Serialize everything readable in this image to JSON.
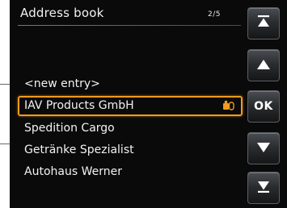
{
  "header": {
    "title": "Address book",
    "page_counter": "2/5"
  },
  "list": {
    "items": [
      {
        "label": "<new entry>",
        "selected": false
      },
      {
        "label": "IAV Products GmbH",
        "selected": true,
        "badge_icon": "contact-card-icon"
      },
      {
        "label": "Spedition Cargo",
        "selected": false
      },
      {
        "label": "Getränke Spezialist",
        "selected": false
      },
      {
        "label": "Autohaus Werner",
        "selected": false
      }
    ]
  },
  "side_buttons": {
    "page_up_icon": "page-up-icon",
    "scroll_up_icon": "up-arrow-icon",
    "ok_label": "OK",
    "scroll_down_icon": "down-arrow-icon",
    "page_down_icon": "page-down-icon"
  },
  "colors": {
    "screen_background": "#0a0a0a",
    "text": "#f2f2f2",
    "selection_accent": "#f09a1e",
    "button_face": "#2b2d30"
  }
}
